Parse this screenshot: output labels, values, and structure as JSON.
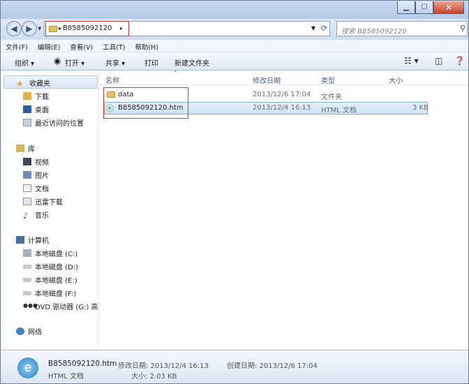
{
  "address": {
    "crumb": "B8585092120"
  },
  "search": {
    "placeholder": "搜索 B8585092120"
  },
  "menu": [
    "文件(F)",
    "编辑(E)",
    "查看(V)",
    "工具(T)",
    "帮助(H)"
  ],
  "toolbar": {
    "organize": "组织 ▾",
    "open": "打开 ▾",
    "share": "共享 ▾",
    "print": "打印",
    "new_folder": "新建文件夹"
  },
  "sidebar": {
    "favorites": "收藏夹",
    "fav_items": [
      "下载",
      "桌面",
      "最近访问的位置"
    ],
    "libraries": "库",
    "lib_items": [
      "视频",
      "图片",
      "文档",
      "迅雷下载",
      "音乐"
    ],
    "computer": "计算机",
    "comp_items": [
      "本地磁盘 (C:)",
      "本地磁盘 (D:)",
      "本地磁盘 (E:)",
      "本地磁盘 (F:)",
      "DVD 驱动器 (G:) 高"
    ],
    "network": "网络"
  },
  "columns": {
    "name": "名称",
    "modified": "修改日期",
    "type": "类型",
    "size": "大小"
  },
  "files": [
    {
      "name": "data",
      "modified": "2013/12/6 17:04",
      "type": "文件夹",
      "size": ""
    },
    {
      "name": "B8585092120.htm",
      "modified": "2013/12/4 16:13",
      "type": "HTML 文档",
      "size": "3 KB"
    }
  ],
  "status": {
    "filename": "B8585092120.htm",
    "modified": "修改日期: 2013/12/4 16:13",
    "created": "创建日期: 2013/12/6 17:04",
    "type": "HTML 文档",
    "size": "大小: 2.03 KB"
  }
}
